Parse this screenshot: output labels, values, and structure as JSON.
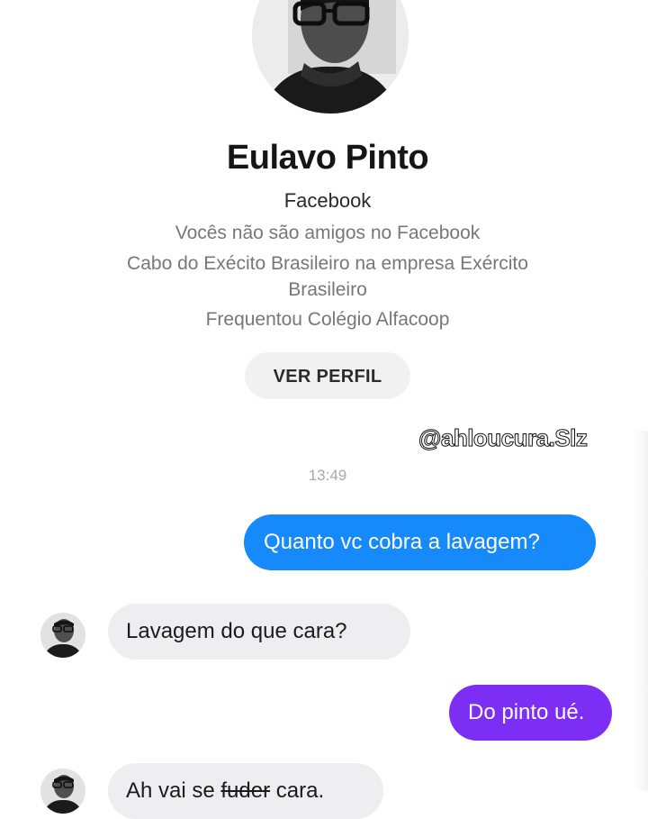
{
  "profile": {
    "name": "Eulavo Pinto",
    "source": "Facebook",
    "friend_status": "Vocês não são amigos no Facebook",
    "work_line1": "Cabo do Exécito Brasileiro na empresa Exército",
    "work_line2": "Brasileiro",
    "education": "Frequentou Colégio Alfacoop",
    "ver_perfil_label": "VER PERFIL"
  },
  "watermark": "@ahloucura.Slz",
  "chat": {
    "timestamp": "13:49",
    "messages": [
      {
        "from": "me",
        "text": "Quanto vc cobra a lavagem?"
      },
      {
        "from": "them",
        "text": "Lavagem do que cara?"
      },
      {
        "from": "me",
        "text": "Do pinto ué."
      },
      {
        "from": "them",
        "text_before": "Ah vai se ",
        "text_struck": "fuder",
        "text_after": " cara."
      }
    ]
  },
  "colors": {
    "sent_bubble_1": "#1689fb",
    "sent_bubble_2": "#7d2ef5",
    "received_bubble": "#eeeef0",
    "meta_text": "#777777"
  }
}
